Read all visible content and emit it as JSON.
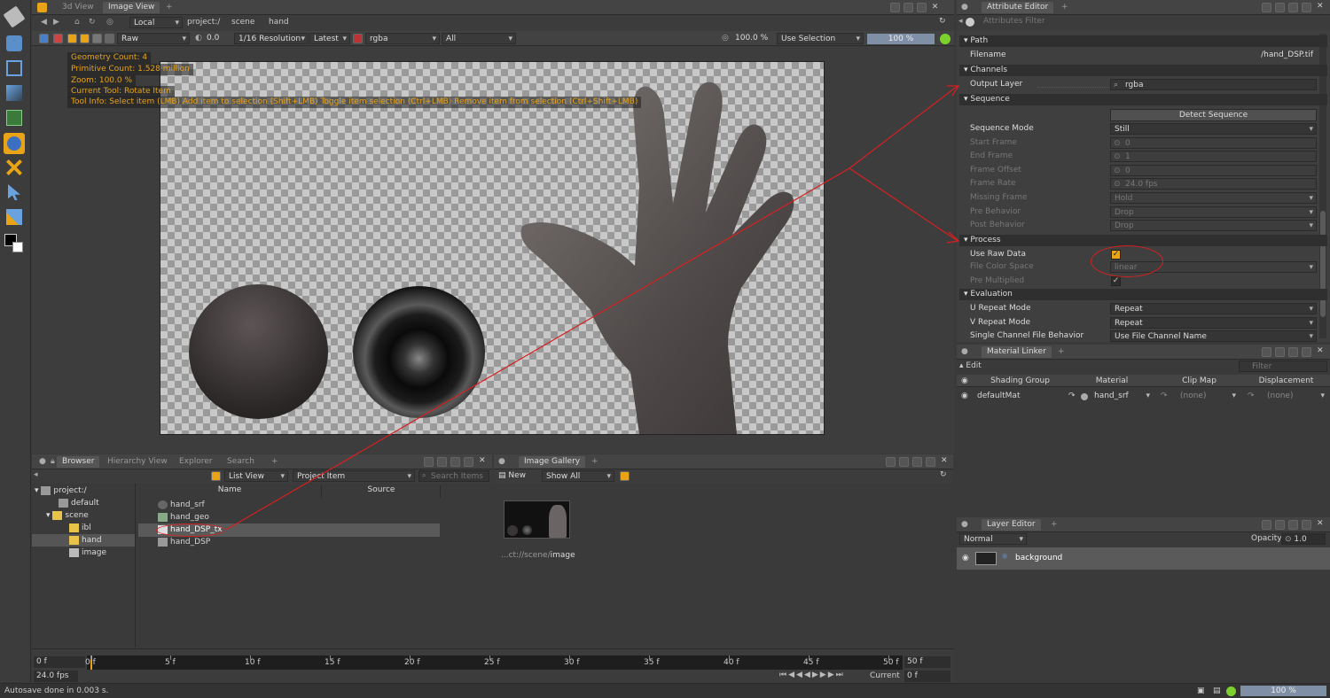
{
  "viewer": {
    "tabs": [
      "3d View",
      "Image View"
    ],
    "context": "Local",
    "breadcrumb": [
      "project:/",
      "scene",
      "hand"
    ],
    "lut": "Raw",
    "exposure": "0.0",
    "resolution": "1/16 Resolution",
    "version": "Latest",
    "channel": "rgba",
    "layer": "All",
    "zoom": "100.0 %",
    "selection": "Use Selection",
    "progress": "100 %"
  },
  "hud": {
    "geometry": "Geometry Count: 4",
    "primitive": "Primitive Count: 1.528 million",
    "zoom": "Zoom: 100.0 %",
    "tool": "Current Tool: Rotate Item",
    "info": "Tool Info: Select item (LMB)  Add item to selection (Shift+LMB)  Toggle item selection (Ctrl+LMB)  Remove item from selection (Ctrl+Shift+LMB)"
  },
  "attr": {
    "tab": "Attribute Editor",
    "filter": "Attributes Filter",
    "sections": {
      "path": "Path",
      "channels": "Channels",
      "sequence": "Sequence",
      "process": "Process",
      "evaluation": "Evaluation"
    },
    "filename_label": "Filename",
    "filename": "/hand_DSP.tif",
    "output_label": "Output Layer",
    "output": "rgba",
    "detect": "Detect Sequence",
    "seq_mode_label": "Sequence Mode",
    "seq_mode": "Still",
    "start_label": "Start Frame",
    "start": "0",
    "end_label": "End Frame",
    "end": "1",
    "offset_label": "Frame Offset",
    "offset": "0",
    "rate_label": "Frame Rate",
    "rate": "24.0 fps",
    "missing_label": "Missing Frame",
    "missing": "Hold",
    "pre_label": "Pre Behavior",
    "pre": "Drop",
    "post_label": "Post Behavior",
    "post": "Drop",
    "raw_label": "Use Raw Data",
    "fcs_label": "File Color Space",
    "fcs": "linear",
    "premult_label": "Pre Multiplied",
    "u_label": "U Repeat Mode",
    "u": "Repeat",
    "v_label": "V Repeat Mode",
    "v": "Repeat",
    "scfb_label": "Single Channel File Behavior",
    "scfb": "Use File Channel Name"
  },
  "linker": {
    "tab": "Material Linker",
    "edit": "Edit",
    "filter": "Filter",
    "cols": [
      "Shading Group",
      "Material",
      "Clip Map",
      "Displacement"
    ],
    "row": {
      "group": "defaultMat",
      "material": "hand_srf",
      "clip": "(none)",
      "disp": "(none)"
    }
  },
  "layer": {
    "tab": "Layer Editor",
    "blend": "Normal",
    "opacity_label": "Opacity",
    "opacity": "1.0",
    "item": "background"
  },
  "browser": {
    "tabs": [
      "Browser",
      "Hierarchy View",
      "Explorer",
      "Search"
    ],
    "view": "List View",
    "filter": "Project Item",
    "search": "Search Items",
    "cols": [
      "Name",
      "Source"
    ],
    "tree": [
      "project:/",
      "default",
      "scene",
      "ibl",
      "hand",
      "image"
    ],
    "items": [
      "hand_srf",
      "hand_geo",
      "hand_DSP_tx",
      "hand_DSP"
    ]
  },
  "gallery": {
    "tab": "Image Gallery",
    "new": "New",
    "show": "Show All",
    "path_prefix": "...ct://scene/",
    "path_leaf": "image"
  },
  "timeline": {
    "start": "0 f",
    "end": "50 f",
    "fps": "24.0 fps",
    "current_label": "Current",
    "current": "0 f",
    "ticks": [
      "0 f",
      "5 f",
      "10 f",
      "15 f",
      "20 f",
      "25 f",
      "30 f",
      "35 f",
      "40 f",
      "45 f",
      "50 f"
    ]
  },
  "status": {
    "msg": "Autosave done in 0.003 s.",
    "progress": "100 %"
  },
  "colors": {
    "accent": "#e8a317",
    "annot": "#d62020",
    "bg": "#3a3a3a"
  }
}
